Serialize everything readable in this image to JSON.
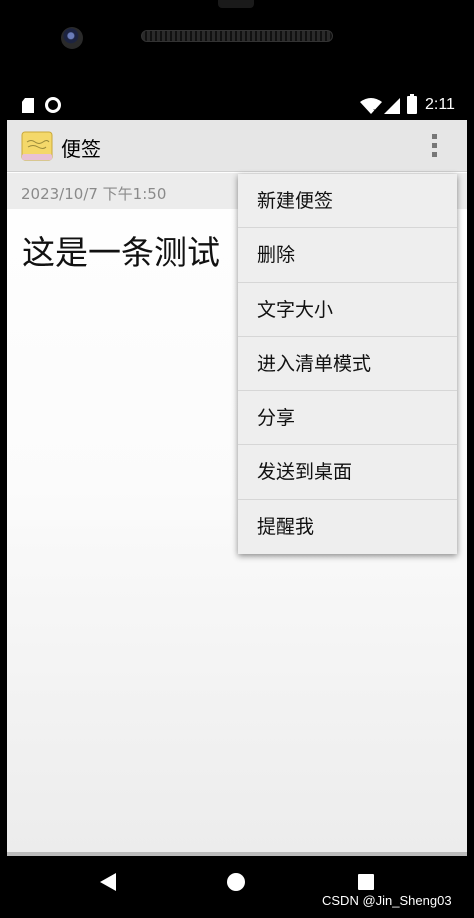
{
  "status_bar": {
    "time": "2:11"
  },
  "action_bar": {
    "title": "便签"
  },
  "note": {
    "date": "2023/10/7 下午1:50",
    "content": "这是一条测试"
  },
  "menu": {
    "items": [
      "新建便签",
      "删除",
      "文字大小",
      "进入清单模式",
      "分享",
      "发送到桌面",
      "提醒我"
    ]
  },
  "watermark": "CSDN @Jin_Sheng03",
  "colors": {
    "action_bar": "#e6e6e6",
    "menu_bg": "#eeeeee",
    "date_text": "#8a8a8a"
  }
}
